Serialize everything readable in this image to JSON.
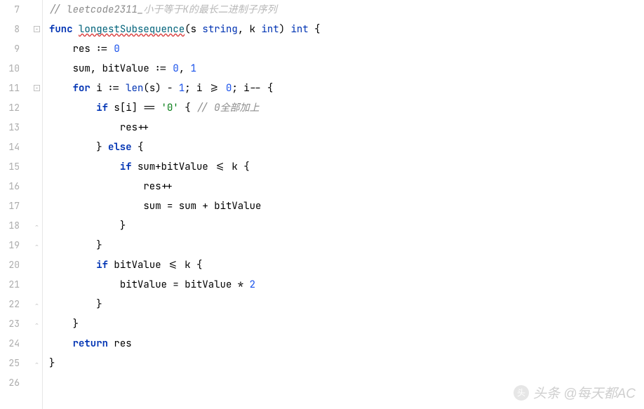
{
  "gutter": {
    "start": 7,
    "end": 26
  },
  "code": {
    "l7": {
      "comment_prefix": "// leetcode2311_",
      "comment_cn": "小于等于K的最长二进制子序列"
    },
    "l8": {
      "kw_func": "func",
      "fn_name": "longestSubsequence",
      "sig_open": "(s ",
      "type_string": "string",
      "sig_mid": ", k ",
      "type_int1": "int",
      "sig_close": ") ",
      "ret_int": "int",
      "brace": " {"
    },
    "l9": {
      "text_a": "res := ",
      "num": "0"
    },
    "l10": {
      "text_a": "sum, bitValue := ",
      "num1": "0",
      "comma": ", ",
      "num2": "1"
    },
    "l11": {
      "kw_for": "for",
      "text_a": " i := ",
      "builtin_len": "len",
      "text_b": "(s) - ",
      "num1": "1",
      "text_c": "; i >= ",
      "num0": "0",
      "text_d": "; i-- {"
    },
    "l12": {
      "kw_if": "if",
      "text_a": " s[i] == ",
      "str": "'0'",
      "brace": " { ",
      "comment": "// 0全部加上"
    },
    "l13": {
      "text": "res++"
    },
    "l14": {
      "close": "}",
      "kw_else": " else ",
      "open": "{"
    },
    "l15": {
      "kw_if": "if",
      "text": " sum+bitValue <= k {"
    },
    "l16": {
      "text": "res++"
    },
    "l17": {
      "text": "sum = sum + bitValue"
    },
    "l18": {
      "close": "}"
    },
    "l19": {
      "close": "}"
    },
    "l20": {
      "kw_if": "if",
      "text": " bitValue <= k {"
    },
    "l21": {
      "text_a": "bitValue = bitValue * ",
      "num": "2"
    },
    "l22": {
      "close": "}"
    },
    "l23": {
      "close": "}"
    },
    "l24": {
      "kw_return": "return",
      "text": " res"
    },
    "l25": {
      "close": "}"
    }
  },
  "watermark": {
    "text": "头条 @每天都AC"
  }
}
